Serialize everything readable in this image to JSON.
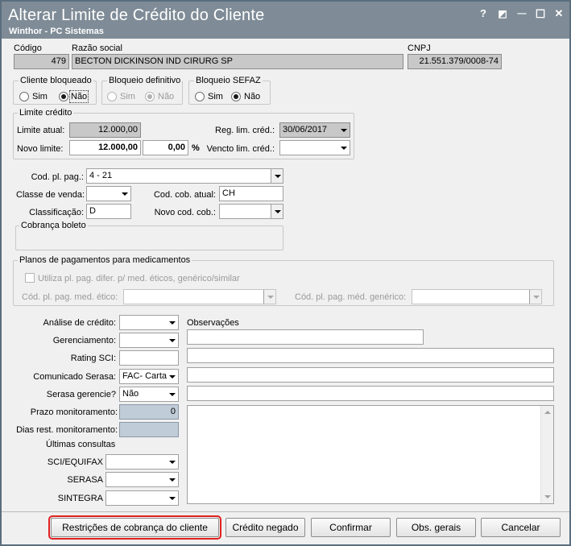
{
  "window": {
    "title": "Alterar Limite de Crédito do Cliente",
    "subtitle": "Winthor - PC Sistemas",
    "help_glyph": "?",
    "restore_glyph": "◩",
    "minimize_glyph": "—",
    "maximize_glyph": "☐",
    "close_glyph": "✕"
  },
  "client": {
    "codigo_label": "Código",
    "codigo_value": "479",
    "razao_label": "Razão social",
    "razao_value": "BECTON DICKINSON IND CIRURG SP",
    "cnpj_label": "CNPJ",
    "cnpj_value": "21.551.379/0008-74"
  },
  "bloqueios": {
    "cliente_bloqueado": {
      "title": "Cliente bloqueado",
      "sim": "Sim",
      "nao": "Não",
      "selected": "Não"
    },
    "bloqueio_definitivo": {
      "title": "Bloqueio definitivo",
      "sim": "Sim",
      "nao": "Não",
      "selected": "Não"
    },
    "bloqueio_sefaz": {
      "title": "Bloqueio SEFAZ",
      "sim": "Sim",
      "nao": "Não",
      "selected": "Não"
    }
  },
  "limite": {
    "title": "Limite crédito",
    "limite_atual_label": "Limite atual:",
    "limite_atual_value": "12.000,00",
    "novo_limite_label": "Novo limite:",
    "novo_limite_value": "12.000,00",
    "percent_value": "0,00",
    "percent_sign": "%",
    "reg_lim_label": "Reg. lim. créd.:",
    "reg_lim_value": "30/06/2017",
    "vencto_label": "Vencto lim. créd.:",
    "vencto_value": ""
  },
  "cobranca": {
    "cod_pl_pag_label": "Cod. pl. pag.:",
    "cod_pl_pag_value": "4 - 21",
    "classe_venda_label": "Classe de venda:",
    "classe_venda_value": "",
    "cod_cob_atual_label": "Cod. cob. atual:",
    "cod_cob_atual_value": "CH",
    "classificacao_label": "Classificação:",
    "classificacao_value": "D",
    "novo_cod_cob_label": "Novo cod. cob.:",
    "novo_cod_cob_value": "",
    "boleto_title": "Cobrança boleto"
  },
  "medicamentos": {
    "title": "Planos de pagamentos para medicamentos",
    "checkbox_label": "Utiliza pl. pag. difer. p/ med. éticos, genérico/similar",
    "etico_label": "Cód. pl. pag. med. ético:",
    "etico_value": "",
    "generico_label": "Cód. pl. pag. méd. genérico:",
    "generico_value": ""
  },
  "analise": {
    "analise_credito_label": "Análise de crédito:",
    "analise_credito_value": "",
    "gerenciamento_label": "Gerenciamento:",
    "gerenciamento_value": "",
    "rating_label": "Rating SCI:",
    "rating_value": "",
    "comunicado_label": "Comunicado Serasa:",
    "comunicado_value": "FAC- Carta",
    "serasa_gerencie_label": "Serasa gerencie?",
    "serasa_gerencie_value": "Não",
    "prazo_label": "Prazo monitoramento:",
    "prazo_value": "0",
    "dias_label": "Dias rest. monitoramento:",
    "dias_value": "",
    "ultimas_label": "Últimas consultas",
    "sci_label": "SCI/EQUIFAX",
    "sci_value": "",
    "serasa_label": "SERASA",
    "serasa_value": "",
    "sintegra_label": "SINTEGRA",
    "sintegra_value": "",
    "observacoes_label": "Observações",
    "obs_lines": [
      "",
      "",
      "",
      ""
    ],
    "obs_memo": ""
  },
  "buttons": {
    "restricoes": "Restrições de cobrança do cliente",
    "credito_negado": "Crédito negado",
    "confirmar": "Confirmar",
    "obs_gerais": "Obs. gerais",
    "cancelar": "Cancelar"
  },
  "colors": {
    "titlebar": "#7f8c97",
    "window_bg": "#f0f0f0",
    "readonly_bg": "#c8c8c8",
    "monitor_bg": "#c0ccd8",
    "highlight_outline": "#e02020"
  }
}
